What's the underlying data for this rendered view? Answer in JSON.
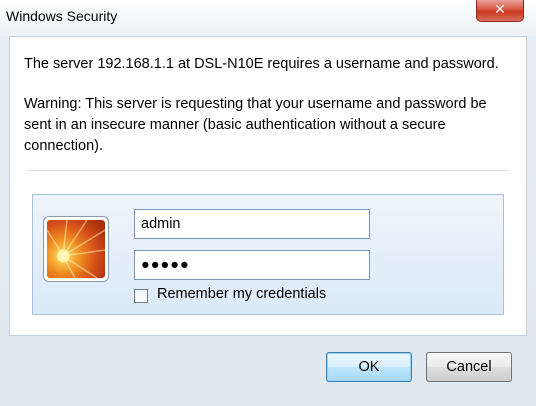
{
  "window": {
    "title": "Windows Security",
    "close_icon": "close-icon"
  },
  "message": {
    "line1": "The server 192.168.1.1 at DSL-N10E requires a username and password.",
    "warning": "Warning: This server is requesting that your username and password be sent in an insecure manner (basic authentication without a secure connection)."
  },
  "credentials": {
    "avatar_icon": "user-avatar-flower-icon",
    "username_value": "admin",
    "password_value": "●●●●●",
    "remember_label": "Remember my credentials",
    "remember_checked": false
  },
  "buttons": {
    "ok_label": "OK",
    "cancel_label": "Cancel"
  },
  "colors": {
    "close_button": "#d8553f",
    "ok_button_accent": "#a7d9f5",
    "panel_border": "#a7c2e0"
  }
}
